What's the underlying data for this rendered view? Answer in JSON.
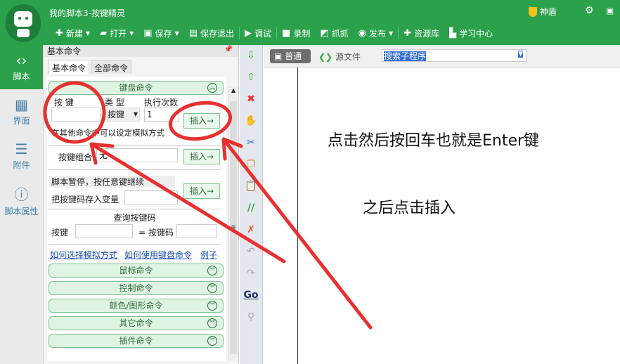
{
  "app": {
    "title": "我的脚本3-按键精灵",
    "shield": "神盾"
  },
  "toolbar": [
    {
      "icon": "plus-icon",
      "label": "新建",
      "dd": true
    },
    {
      "icon": "folder-icon",
      "label": "打开",
      "dd": true
    },
    {
      "icon": "save-icon",
      "label": "保存",
      "dd": true
    },
    {
      "icon": "save-exit-icon",
      "label": "保存退出"
    },
    {
      "icon": "play-icon",
      "label": "调试"
    },
    {
      "icon": "record-icon",
      "label": "录制"
    },
    {
      "icon": "capture-icon",
      "label": "抓抓"
    },
    {
      "icon": "publish-icon",
      "label": "发布",
      "dd": true
    },
    {
      "icon": "resource-icon",
      "label": "资源库"
    },
    {
      "icon": "learn-icon",
      "label": "学习中心"
    }
  ],
  "sidebar": [
    {
      "label": "脚本",
      "icon": "script-icon",
      "active": true
    },
    {
      "label": "界面",
      "icon": "ui-icon"
    },
    {
      "label": "附件",
      "icon": "attachment-icon"
    },
    {
      "label": "脚本属性",
      "icon": "info-icon"
    }
  ],
  "panel": {
    "title": "基本命令",
    "tabs": [
      "基本命令",
      "全部命令"
    ],
    "keyboard": {
      "header": "键盘命令",
      "key_label": "按 键",
      "type_label": "类 型",
      "count_label": "执行次数",
      "type_value": "按键",
      "count_value": "1",
      "insert": "插入→",
      "hint": "在其他命令中可以设定模拟方式",
      "combo_label": "按键组合",
      "combo_value": "无",
      "pause_label": "脚本暂停，按任意键继续",
      "store_label": "把按键码存入变量",
      "query_title": "查询按键码",
      "query_key": "按键",
      "query_code": "= 按键码"
    },
    "links": [
      "如何选择模拟方式",
      "如何使用键盘命令",
      "例子"
    ],
    "groups": [
      "鼠标命令",
      "控制命令",
      "颜色/图形命令",
      "其它命令",
      "插件命令"
    ]
  },
  "editor": {
    "mode_normal": "普通",
    "mode_source": "源文件",
    "sub_search": "搜索子程序"
  },
  "annotations": {
    "line1": "点击然后按回车也就是Enter键",
    "line2": "之后点击插入",
    "color": "#e8312f"
  }
}
